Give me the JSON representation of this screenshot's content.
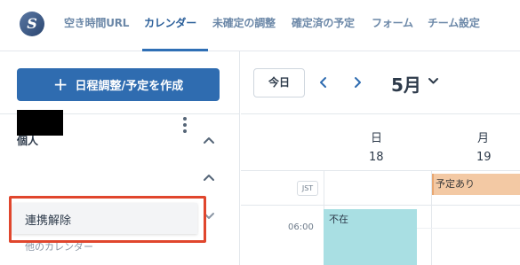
{
  "app": {
    "logo_letter": "S",
    "accent": "#2f6cb0",
    "highlight_color": "#e0462d"
  },
  "nav": {
    "tabs": [
      {
        "label": "空き時間URL"
      },
      {
        "label": "カレンダー",
        "active": true
      },
      {
        "label": "未確定の調整"
      },
      {
        "label": "確定済の予定"
      },
      {
        "label": "フォーム"
      },
      {
        "label": "チーム設定"
      }
    ]
  },
  "sidebar": {
    "create_button": "日程調整/予定を作成",
    "create_icon": "plus-icon",
    "section_title": "個人",
    "other_calendars": "他のカレンダー"
  },
  "popup_menu": {
    "item": "連携解除"
  },
  "calendar": {
    "today_button": "今日",
    "month_label": "5月",
    "timezone": "JST",
    "days": [
      {
        "dow": "日",
        "date": "18"
      },
      {
        "dow": "月",
        "date": "19"
      }
    ],
    "time_label": "06:00",
    "events": {
      "busy": "予定あり",
      "absent": "不在"
    }
  }
}
